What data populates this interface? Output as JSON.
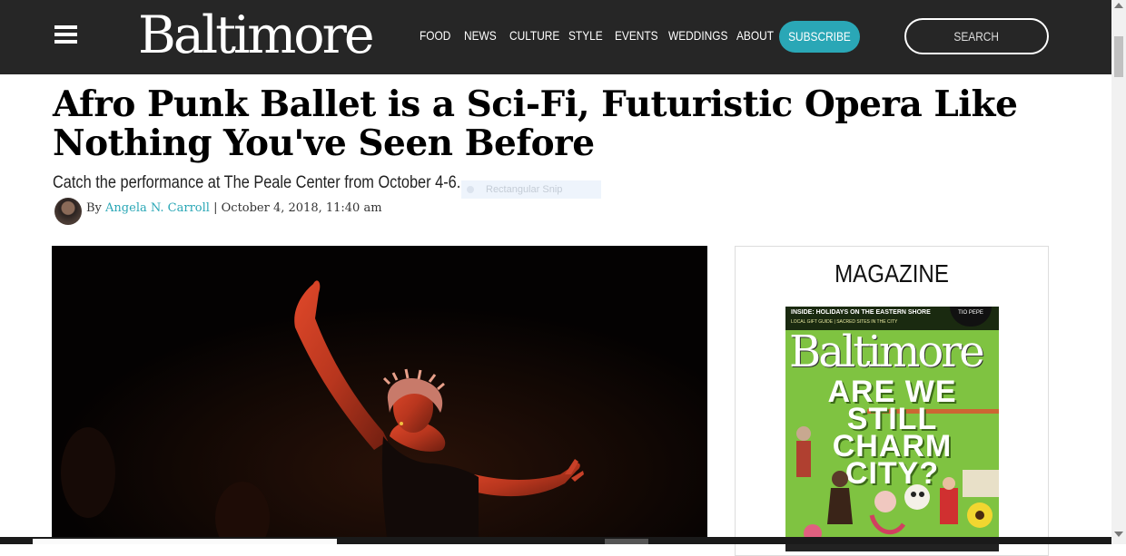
{
  "header": {
    "logo": "Baltimore",
    "nav": [
      "FOOD",
      "NEWS",
      "CULTURE",
      "STYLE",
      "EVENTS",
      "WEDDINGS",
      "ABOUT"
    ],
    "subscribe_label": "SUBSCRIBE",
    "search_label": "SEARCH"
  },
  "article": {
    "headline": "Afro Punk Ballet is a Sci-Fi, Futuristic Opera Like Nothing You've Seen Before",
    "subhead": "Catch the performance at The Peale Center from October 4-6.",
    "byline_prefix": "By",
    "author": "Angela N. Carroll",
    "separator": "|",
    "date": "October 4, 2018, 11:40 am"
  },
  "overlay": {
    "snip_label": "Rectangular Snip"
  },
  "sidebar": {
    "title": "MAGAZINE",
    "cover": {
      "inside_line": "INSIDE: HOLIDAYS ON THE EASTERN SHORE",
      "sub_line": "LOCAL GIFT GUIDE  |  SACRED SITES IN THE CITY",
      "badge": "TIO PEPE",
      "masthead": "Baltimore",
      "cover_lines": [
        "ARE WE",
        "STILL",
        "CHARM",
        "CITY?"
      ]
    }
  },
  "colors": {
    "topbar": "#262626",
    "accent": "#2aa7b6",
    "cover_green": "#7fc341"
  },
  "icons": [
    "menu-icon",
    "scroll-up-icon",
    "scroll-down-icon"
  ]
}
